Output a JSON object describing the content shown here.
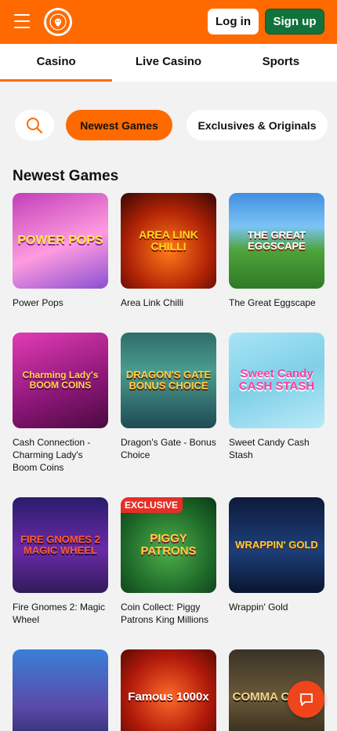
{
  "header": {
    "menu_icon": "hamburger-menu-icon",
    "logo_icon": "lion-logo-icon",
    "login_label": "Log in",
    "signup_label": "Sign up",
    "colors": {
      "brand": "#ff6a00",
      "signup": "#11733b"
    }
  },
  "tabs": [
    {
      "label": "Casino",
      "active": true
    },
    {
      "label": "Live Casino",
      "active": false
    },
    {
      "label": "Sports",
      "active": false
    }
  ],
  "filters": {
    "search_icon": "search-icon",
    "newest_label": "Newest Games",
    "exclusives_label": "Exclusives & Originals"
  },
  "section": {
    "title": "Newest Games"
  },
  "games": [
    {
      "name": "Power Pops",
      "art": "POWER POPS",
      "badge": ""
    },
    {
      "name": "Area Link Chilli",
      "art": "AREA LINK CHILLI",
      "badge": ""
    },
    {
      "name": "The Great Eggscape",
      "art": "THE GREAT EGGSCAPE",
      "badge": ""
    },
    {
      "name": "Cash Connection - Charming Lady's Boom Coins",
      "art": "Charming Lady's BOOM COINS",
      "badge": ""
    },
    {
      "name": "Dragon's Gate - Bonus Choice",
      "art": "DRAGON'S GATE BONUS CHOICE",
      "badge": ""
    },
    {
      "name": "Sweet Candy Cash Stash",
      "art": "Sweet Candy CASH STASH",
      "badge": ""
    },
    {
      "name": "Fire Gnomes 2: Magic Wheel",
      "art": "FIRE GNOMES 2 MAGIC WHEEL",
      "badge": ""
    },
    {
      "name": "Coin Collect: Piggy Patrons King Millions",
      "art": "PIGGY PATRONS",
      "badge": "EXCLUSIVE"
    },
    {
      "name": "Wrappin' Gold",
      "art": "WRAPPIN' GOLD",
      "badge": ""
    },
    {
      "name": "",
      "art": "",
      "badge": ""
    },
    {
      "name": "",
      "art": "Famous 1000x",
      "badge": ""
    },
    {
      "name": "",
      "art": "COMMA COLLE",
      "badge": ""
    }
  ],
  "chat_icon": "chat-bubble-icon"
}
